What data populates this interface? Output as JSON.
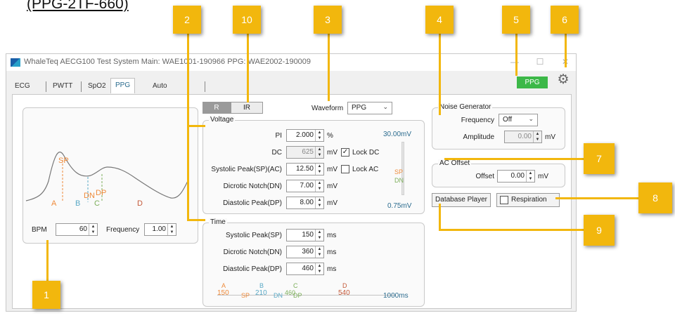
{
  "heading": "(PPG-2TF-660)",
  "window": {
    "title": "WhaleTeq AECG100 Test System   Main: WAE1001-190966  PPG: WAE2002-190009",
    "minimize": "—",
    "maximize": "☐",
    "close": "✕"
  },
  "tabs": [
    "ECG",
    "PWTT",
    "SpO2",
    "PPG",
    "Auto Sequence"
  ],
  "ppg_button": "PPG",
  "waveform_preview": {
    "markers": [
      "A",
      "SP",
      "B",
      "DN",
      "DP",
      "C",
      "D"
    ],
    "bpm_label": "BPM",
    "bpm_value": "60",
    "frequency_label": "Frequency",
    "frequency_value": "1.00"
  },
  "toggle": {
    "r": "R",
    "ir": "IR"
  },
  "waveform": {
    "label": "Waveform",
    "value": "PPG",
    "arrow": "⌄"
  },
  "voltage": {
    "legend": "Voltage",
    "pi_label": "PI",
    "pi_value": "2.000",
    "pi_unit": "%",
    "dc_label": "DC",
    "dc_value": "625",
    "dc_unit": "mV",
    "lock_dc": "Lock DC",
    "lock_dc_checked": "✓",
    "sp_label": "Systolic Peak(SP)(AC)",
    "sp_value": "12.50",
    "sp_unit": "mV",
    "lock_ac": "Lock AC",
    "dn_label": "Dicrotic Notch(DN)",
    "dn_value": "7.00",
    "dn_unit": "mV",
    "dp_label": "Diastolic Peak(DP)",
    "dp_value": "8.00",
    "dp_unit": "mV",
    "scale_top": "30.00mV",
    "scale_bottom": "0.75mV",
    "scale_sp": "SP",
    "scale_dn": "DN"
  },
  "time": {
    "legend": "Time",
    "sp_label": "Systolic Peak(SP)",
    "sp_value": "150",
    "sp_unit": "ms",
    "dn_label": "Dicrotic Notch(DN)",
    "dn_value": "360",
    "dn_unit": "ms",
    "dp_label": "Diastolic Peak(DP)",
    "dp_value": "460",
    "dp_unit": "ms",
    "timeline": {
      "a_label": "A",
      "a_value": "150",
      "sp_label": "SP",
      "b_label": "B",
      "b_value": "210",
      "dn_label": "DN",
      "c_label": "C",
      "c_value": "460",
      "dp_label": "DP",
      "d_label": "D",
      "d_value": "540",
      "end": "1000ms"
    }
  },
  "noise": {
    "legend": "Noise Generator",
    "frequency_label": "Frequency",
    "frequency_value": "Off",
    "amplitude_label": "Amplitude",
    "amplitude_value": "0.00",
    "amplitude_unit": "mV"
  },
  "ac_offset": {
    "legend": "AC Offset",
    "offset_label": "Offset",
    "offset_value": "0.00",
    "offset_unit": "mV"
  },
  "database_player": "Database Player",
  "respiration": "Respiration",
  "callouts": [
    "1",
    "2",
    "3",
    "4",
    "5",
    "6",
    "7",
    "8",
    "9",
    "10"
  ],
  "colors": {
    "callout": "#f2b70d",
    "ppg_button": "#3cb848",
    "a": "#ee8a3a",
    "b": "#5aa9c6",
    "c": "#7cae5a",
    "d": "#c45a3a",
    "tab_active": "#2a6b8e"
  }
}
